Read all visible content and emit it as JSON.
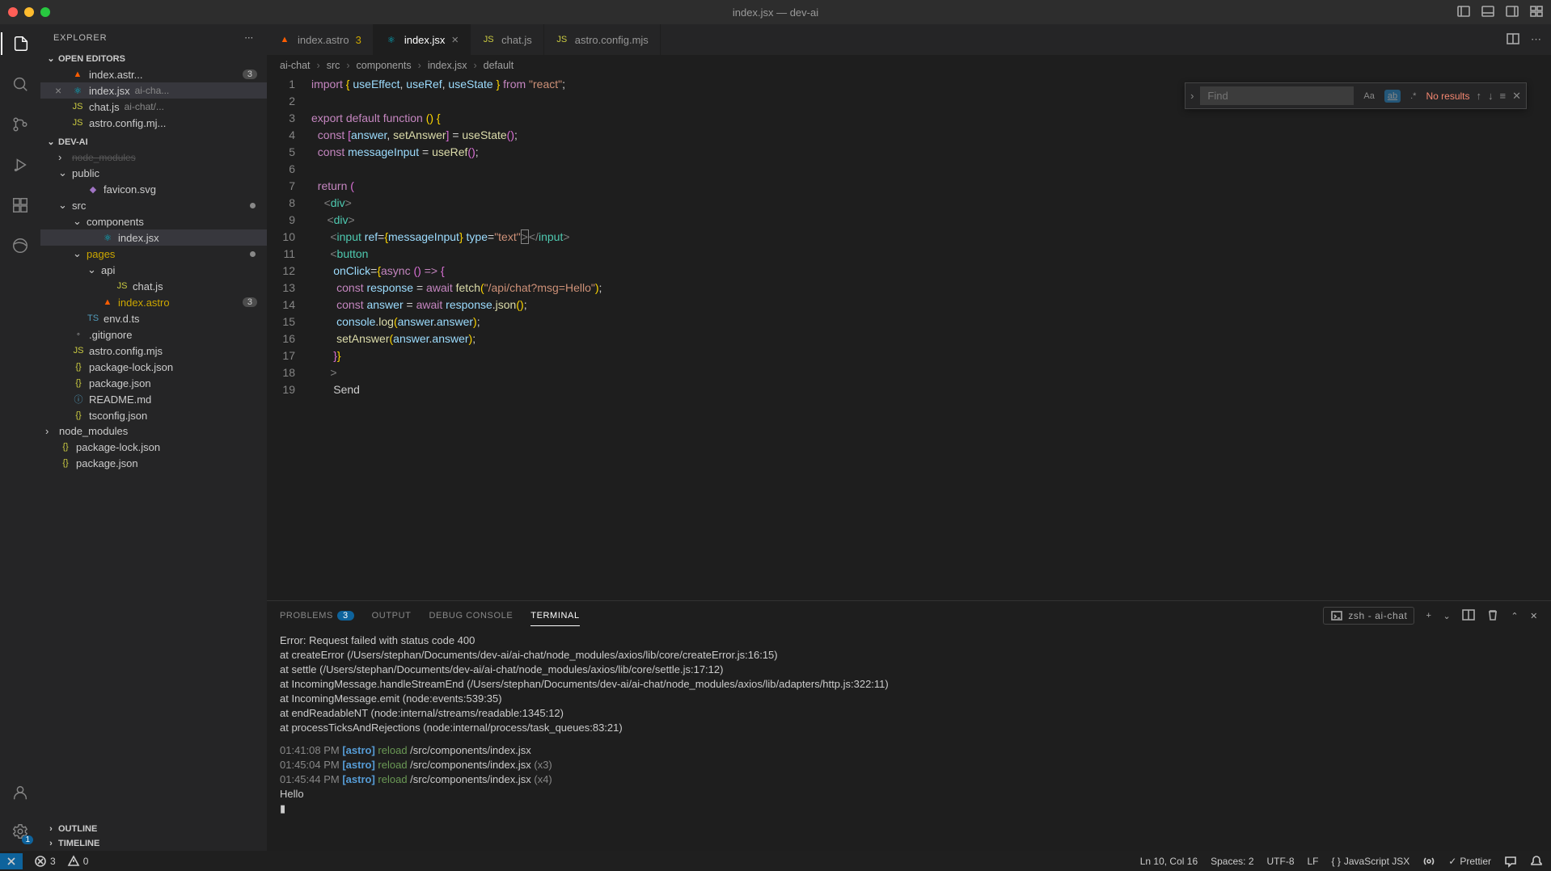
{
  "window": {
    "title": "index.jsx — dev-ai"
  },
  "sidebar": {
    "title": "EXPLORER",
    "sections": {
      "open_editors": {
        "label": "OPEN EDITORS",
        "items": [
          {
            "name": "index.astr...",
            "badge": "3",
            "icon": "astro"
          },
          {
            "name": "index.jsx",
            "hint": "ai-cha...",
            "icon": "react",
            "active": true
          },
          {
            "name": "chat.js",
            "hint": "ai-chat/...",
            "icon": "js"
          },
          {
            "name": "astro.config.mj...",
            "icon": "js"
          }
        ]
      },
      "project": {
        "label": "DEV-AI",
        "tree": [
          {
            "name": "node_modules",
            "depth": 1,
            "folder": true,
            "dim": true,
            "open": false,
            "strike": true
          },
          {
            "name": "public",
            "depth": 1,
            "folder": true,
            "open": true
          },
          {
            "name": "favicon.svg",
            "depth": 2,
            "icon": "svg"
          },
          {
            "name": "src",
            "depth": 1,
            "folder": true,
            "open": true,
            "dot": true
          },
          {
            "name": "components",
            "depth": 2,
            "folder": true,
            "open": true
          },
          {
            "name": "index.jsx",
            "depth": 3,
            "icon": "react",
            "selected": true
          },
          {
            "name": "pages",
            "depth": 2,
            "folder": true,
            "open": true,
            "warn": true,
            "dot": true
          },
          {
            "name": "api",
            "depth": 3,
            "folder": true,
            "open": true
          },
          {
            "name": "chat.js",
            "depth": 4,
            "icon": "js"
          },
          {
            "name": "index.astro",
            "depth": 3,
            "icon": "astro",
            "warn": true,
            "badge": "3"
          },
          {
            "name": "env.d.ts",
            "depth": 2,
            "icon": "ts"
          },
          {
            "name": ".gitignore",
            "depth": 1,
            "icon": "git"
          },
          {
            "name": "astro.config.mjs",
            "depth": 1,
            "icon": "js"
          },
          {
            "name": "package-lock.json",
            "depth": 1,
            "icon": "json"
          },
          {
            "name": "package.json",
            "depth": 1,
            "icon": "json"
          },
          {
            "name": "README.md",
            "depth": 1,
            "icon": "md"
          },
          {
            "name": "tsconfig.json",
            "depth": 1,
            "icon": "json"
          },
          {
            "name": "node_modules",
            "depth": 0,
            "folder": true,
            "open": false
          },
          {
            "name": "package-lock.json",
            "depth": 0,
            "icon": "json"
          },
          {
            "name": "package.json",
            "depth": 0,
            "icon": "json"
          }
        ]
      },
      "outline": {
        "label": "OUTLINE"
      },
      "timeline": {
        "label": "TIMELINE"
      }
    }
  },
  "tabs": [
    {
      "name": "index.astro",
      "icon": "astro",
      "badge": "3"
    },
    {
      "name": "index.jsx",
      "icon": "react",
      "active": true
    },
    {
      "name": "chat.js",
      "icon": "js"
    },
    {
      "name": "astro.config.mjs",
      "icon": "js"
    }
  ],
  "breadcrumb": [
    "ai-chat",
    "src",
    "components",
    "index.jsx",
    "default"
  ],
  "find": {
    "placeholder": "Find",
    "result": "No results"
  },
  "code": {
    "lines": [
      {
        "n": 1,
        "html": "<span class='k'>import</span> <span class='br'>{</span> <span class='v'>useEffect</span><span class='op'>,</span> <span class='v'>useRef</span><span class='op'>,</span> <span class='v'>useState</span> <span class='br'>}</span> <span class='k'>from</span> <span class='s'>\"react\"</span><span class='op'>;</span>"
      },
      {
        "n": 2,
        "html": ""
      },
      {
        "n": 3,
        "html": "<span class='k'>export</span> <span class='k'>default</span> <span class='k'>function</span> <span class='br'>(</span><span class='br'>)</span> <span class='br'>{</span>"
      },
      {
        "n": 4,
        "html": "  <span class='k'>const</span> <span class='br2'>[</span><span class='v'>answer</span><span class='op'>,</span> <span class='f'>setAnswer</span><span class='br2'>]</span> <span class='op'>=</span> <span class='f'>useState</span><span class='br2'>(</span><span class='br2'>)</span><span class='op'>;</span>"
      },
      {
        "n": 5,
        "html": "  <span class='k'>const</span> <span class='v'>messageInput</span> <span class='op'>=</span> <span class='f'>useRef</span><span class='br2'>(</span><span class='br2'>)</span><span class='op'>;</span>"
      },
      {
        "n": 6,
        "html": ""
      },
      {
        "n": 7,
        "html": "  <span class='k'>return</span> <span class='br2'>(</span>"
      },
      {
        "n": 8,
        "html": "    <span class='pn'>&lt;</span><span class='tag'>div</span><span class='pn'>&gt;</span>"
      },
      {
        "n": 9,
        "html": "     <span class='pn'>&lt;</span><span class='tag'>div</span><span class='pn'>&gt;</span>"
      },
      {
        "n": 10,
        "html": "      <span class='pn'>&lt;</span><span class='tag'>input</span> <span class='attr'>ref</span><span class='op'>=</span><span class='br'>{</span><span class='v'>messageInput</span><span class='br'>}</span> <span class='attr'>type</span><span class='op'>=</span><span class='s'>\"text\"</span><span class='cursor-box'><span class='pn'>&gt;</span></span><span class='pn'>&lt;/</span><span class='tag'>input</span><span class='pn'>&gt;</span>"
      },
      {
        "n": 11,
        "html": "      <span class='pn'>&lt;</span><span class='tag'>button</span>"
      },
      {
        "n": 12,
        "html": "       <span class='attr'>onClick</span><span class='op'>=</span><span class='br'>{</span><span class='k'>async</span> <span class='br2'>(</span><span class='br2'>)</span> <span class='k'>=&gt;</span> <span class='br2'>{</span>"
      },
      {
        "n": 13,
        "html": "        <span class='k'>const</span> <span class='v'>response</span> <span class='op'>=</span> <span class='k'>await</span> <span class='f'>fetch</span><span class='br'>(</span><span class='s'>\"/api/chat?msg=Hello\"</span><span class='br'>)</span><span class='op'>;</span>"
      },
      {
        "n": 14,
        "html": "        <span class='k'>const</span> <span class='v'>answer</span> <span class='op'>=</span> <span class='k'>await</span> <span class='v'>response</span><span class='op'>.</span><span class='f'>json</span><span class='br'>(</span><span class='br'>)</span><span class='op'>;</span>"
      },
      {
        "n": 15,
        "html": "        <span class='v'>console</span><span class='op'>.</span><span class='f'>log</span><span class='br'>(</span><span class='v'>answer</span><span class='op'>.</span><span class='v'>answer</span><span class='br'>)</span><span class='op'>;</span>"
      },
      {
        "n": 16,
        "html": "        <span class='f'>setAnswer</span><span class='br'>(</span><span class='v'>answer</span><span class='op'>.</span><span class='v'>answer</span><span class='br'>)</span><span class='op'>;</span>"
      },
      {
        "n": 17,
        "html": "       <span class='br2'>}</span><span class='br'>}</span>"
      },
      {
        "n": 18,
        "html": "      <span class='pn'>&gt;</span>"
      },
      {
        "n": 19,
        "html": "       Send"
      }
    ]
  },
  "panel": {
    "tabs": [
      {
        "label": "PROBLEMS",
        "badge": "3"
      },
      {
        "label": "OUTPUT"
      },
      {
        "label": "DEBUG CONSOLE"
      },
      {
        "label": "TERMINAL",
        "active": true
      }
    ],
    "shell": "zsh - ai-chat",
    "lines": [
      "Error: Request failed with status code 400",
      "    at createError (/Users/stephan/Documents/dev-ai/ai-chat/node_modules/axios/lib/core/createError.js:16:15)",
      "    at settle (/Users/stephan/Documents/dev-ai/ai-chat/node_modules/axios/lib/core/settle.js:17:12)",
      "    at IncomingMessage.handleStreamEnd (/Users/stephan/Documents/dev-ai/ai-chat/node_modules/axios/lib/adapters/http.js:322:11)",
      "    at IncomingMessage.emit (node:events:539:35)",
      "    at endReadableNT (node:internal/streams/readable:1345:12)",
      "    at processTicksAndRejections (node:internal/process/task_queues:83:21)"
    ],
    "reloads": [
      {
        "time": "01:41:08 PM",
        "path": "/src/components/index.jsx",
        "count": ""
      },
      {
        "time": "01:45:04 PM",
        "path": "/src/components/index.jsx",
        "count": "(x3)"
      },
      {
        "time": "01:45:44 PM",
        "path": "/src/components/index.jsx",
        "count": "(x4)"
      }
    ],
    "output": "Hello"
  },
  "statusbar": {
    "remote_badge": "1",
    "errors": "3",
    "warnings": "0",
    "cursor": "Ln 10, Col 16",
    "spaces": "Spaces: 2",
    "encoding": "UTF-8",
    "eol": "LF",
    "lang": "JavaScript JSX",
    "prettier": "Prettier"
  }
}
